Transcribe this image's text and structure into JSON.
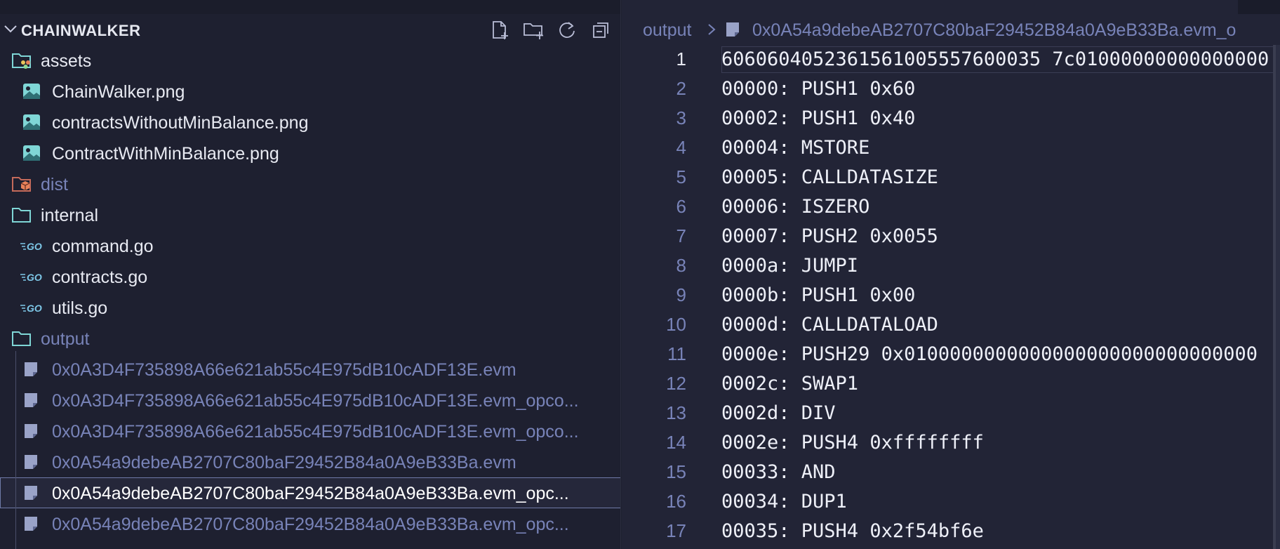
{
  "explorer": {
    "title": "CHAINWALKER",
    "actions": [
      {
        "name": "new-file-icon"
      },
      {
        "name": "new-folder-icon"
      },
      {
        "name": "refresh-icon"
      },
      {
        "name": "collapse-all-icon"
      }
    ],
    "items": [
      {
        "label": "assets",
        "icon": "folder-assets-icon",
        "level": 0,
        "dim": false
      },
      {
        "label": "ChainWalker.png",
        "icon": "image-file-icon",
        "level": 1,
        "dim": false
      },
      {
        "label": "contractsWithoutMinBalance.png",
        "icon": "image-file-icon",
        "level": 1,
        "dim": false
      },
      {
        "label": "ContractWithMinBalance.png",
        "icon": "image-file-icon",
        "level": 1,
        "dim": false
      },
      {
        "label": "dist",
        "icon": "folder-dist-icon",
        "level": 0,
        "dim": true
      },
      {
        "label": "internal",
        "icon": "folder-icon",
        "level": 0,
        "dim": false
      },
      {
        "label": "command.go",
        "icon": "go-file-icon",
        "level": 1,
        "dim": false
      },
      {
        "label": "contracts.go",
        "icon": "go-file-icon",
        "level": 1,
        "dim": false
      },
      {
        "label": "utils.go",
        "icon": "go-file-icon",
        "level": 1,
        "dim": false
      },
      {
        "label": "output",
        "icon": "folder-icon",
        "level": 0,
        "dim": true
      },
      {
        "label": "0x0A3D4F735898A66e621ab55c4E975dB10cADF13E.evm",
        "icon": "file-icon",
        "level": 1,
        "dim": true
      },
      {
        "label": "0x0A3D4F735898A66e621ab55c4E975dB10cADF13E.evm_opco...",
        "icon": "file-icon",
        "level": 1,
        "dim": true
      },
      {
        "label": "0x0A3D4F735898A66e621ab55c4E975dB10cADF13E.evm_opco...",
        "icon": "file-icon",
        "level": 1,
        "dim": true
      },
      {
        "label": "0x0A54a9debeAB2707C80baF29452B84a0A9eB33Ba.evm",
        "icon": "file-icon",
        "level": 1,
        "dim": true
      },
      {
        "label": "0x0A54a9debeAB2707C80baF29452B84a0A9eB33Ba.evm_opc...",
        "icon": "file-icon",
        "level": 1,
        "dim": false,
        "selected": true
      },
      {
        "label": "0x0A54a9debeAB2707C80baF29452B84a0A9eB33Ba.evm_opc...",
        "icon": "file-icon",
        "level": 1,
        "dim": true
      }
    ]
  },
  "editor": {
    "breadcrumb": {
      "folder": "output",
      "file": "0x0A54a9debeAB2707C80baF29452B84a0A9eB33Ba.evm_o"
    },
    "lines": [
      {
        "n": "1",
        "text": "6060604052361561005557600035 7c01000000000000000"
      },
      {
        "n": "2",
        "text": "00000: PUSH1 0x60"
      },
      {
        "n": "3",
        "text": "00002: PUSH1 0x40"
      },
      {
        "n": "4",
        "text": "00004: MSTORE"
      },
      {
        "n": "5",
        "text": "00005: CALLDATASIZE"
      },
      {
        "n": "6",
        "text": "00006: ISZERO"
      },
      {
        "n": "7",
        "text": "00007: PUSH2 0x0055"
      },
      {
        "n": "8",
        "text": "0000a: JUMPI"
      },
      {
        "n": "9",
        "text": "0000b: PUSH1 0x00"
      },
      {
        "n": "10",
        "text": "0000d: CALLDATALOAD"
      },
      {
        "n": "11",
        "text": "0000e: PUSH29 0x0100000000000000000000000000000"
      },
      {
        "n": "12",
        "text": "0002c: SWAP1"
      },
      {
        "n": "13",
        "text": "0002d: DIV"
      },
      {
        "n": "14",
        "text": "0002e: PUSH4 0xffffffff"
      },
      {
        "n": "15",
        "text": "00033: AND"
      },
      {
        "n": "16",
        "text": "00034: DUP1"
      },
      {
        "n": "17",
        "text": "00035: PUSH4 0x2f54bf6e"
      }
    ]
  },
  "colors": {
    "background": "#1e2030",
    "editor_background": "#222436",
    "accent_dim_text": "#7883b8",
    "text": "#e8eaf2",
    "go_icon": "#7ec8e8",
    "folder_icon": "#7fd6d6",
    "dist_icon": "#e8825a"
  }
}
